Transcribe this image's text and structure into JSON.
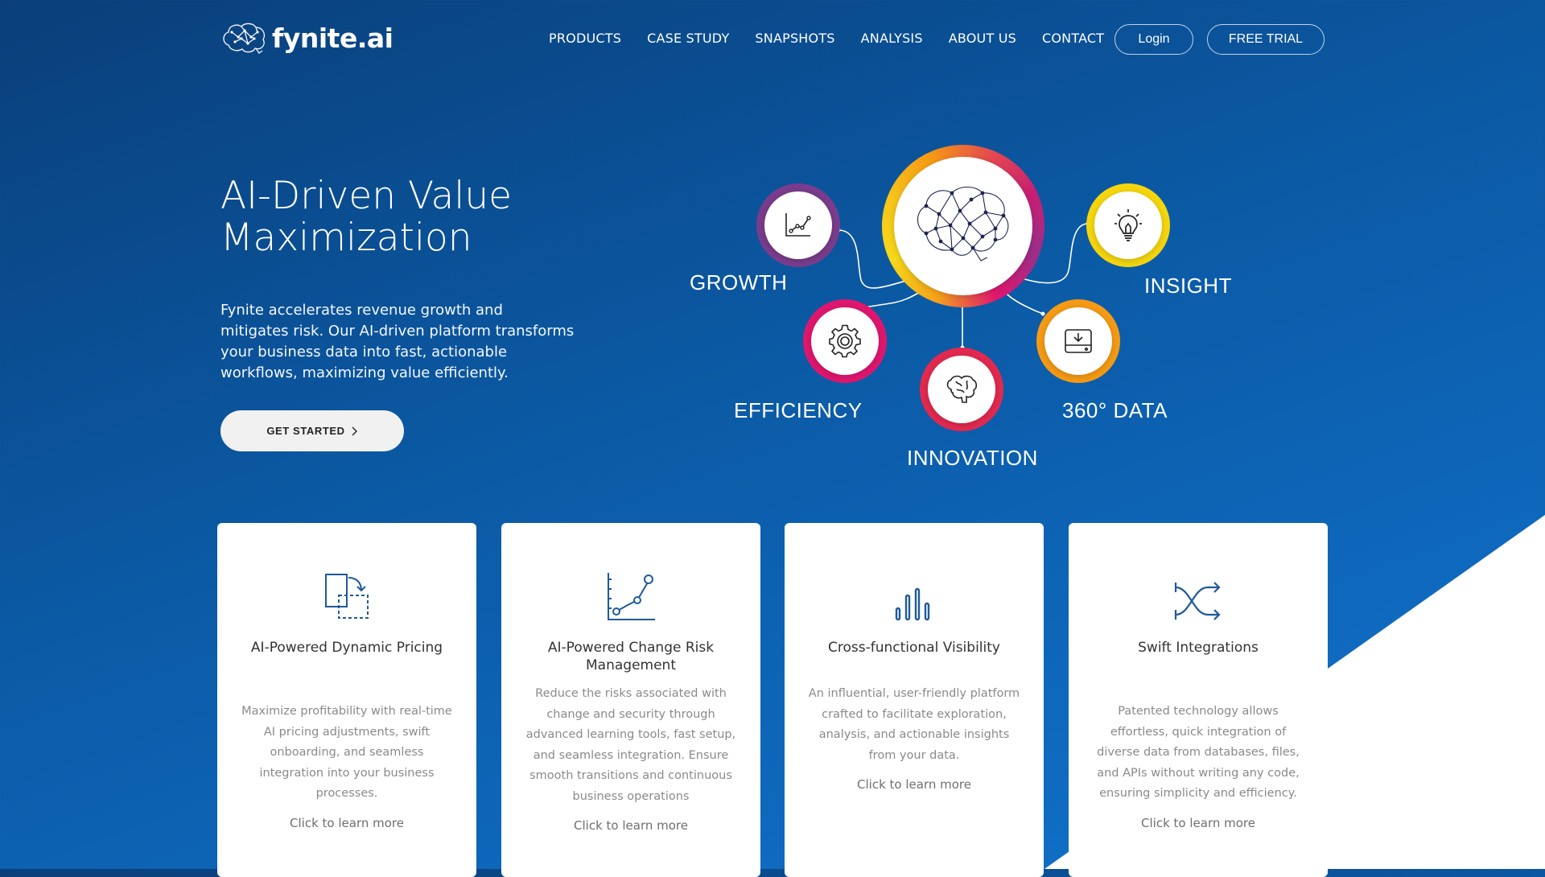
{
  "brand": {
    "name": "fynite.ai"
  },
  "nav": {
    "items": [
      "PRODUCTS",
      "CASE STUDY",
      "SNAPSHOTS",
      "ANALYSIS",
      "ABOUT US",
      "CONTACT"
    ],
    "login_label": "Login",
    "trial_label": "FREE TRIAL"
  },
  "hero": {
    "title": "AI-Driven Value Maximization",
    "description": "Fynite accelerates revenue growth and mitigates risk. Our AI-driven platform transforms your business data into fast, actionable workflows, maximizing value efficiently.",
    "cta_label": "GET STARTED"
  },
  "diagram": {
    "labels": {
      "growth": "GROWTH",
      "insight": "INSIGHT",
      "efficiency": "EFFICIENCY",
      "data": "360° DATA",
      "innovation": "INNOVATION"
    },
    "icons": {
      "center": "brain-network-icon",
      "growth": "line-chart-icon",
      "insight": "lightbulb-icon",
      "efficiency": "gear-icon",
      "data": "storage-download-icon",
      "innovation": "brain-icon"
    }
  },
  "cards": [
    {
      "icon": "dynamic-pricing-icon",
      "title": "AI-Powered Dynamic Pricing",
      "text": "Maximize profitability with real-time AI pricing adjustments, swift onboarding, and seamless integration into your business processes.",
      "link": "Click to learn more"
    },
    {
      "icon": "risk-chart-icon",
      "title": "AI-Powered Change Risk Management",
      "text": "Reduce the risks associated with change and security through advanced learning tools, fast setup, and seamless integration. Ensure smooth transitions and continuous business operations",
      "link": "Click to learn more"
    },
    {
      "icon": "bar-chart-icon",
      "title": "Cross-functional Visibility",
      "text": "An influential, user-friendly platform crafted to facilitate exploration, analysis, and actionable insights from your data.",
      "link": "Click to learn more"
    },
    {
      "icon": "shuffle-icon",
      "title": "Swift Integrations",
      "text": "Patented technology allows effortless, quick integration of diverse data from databases, files, and APIs without writing any code, ensuring simplicity and efficiency.",
      "link": "Click to learn more"
    }
  ],
  "colors": {
    "bg_dark": "#0a3f7a",
    "bg_light": "#1173cf",
    "icon_blue": "#1f5a99",
    "ring_purple": "#7a3c8c",
    "ring_yellow": "#f5d60e",
    "ring_pink": "#e0166e",
    "ring_orange": "#f59a14",
    "ring_red": "#e2294f"
  }
}
